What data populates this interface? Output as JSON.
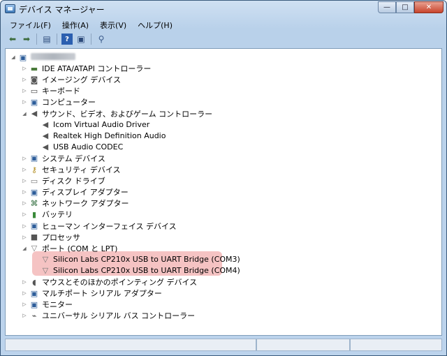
{
  "window": {
    "title": "デバイス マネージャー",
    "caption_buttons": {
      "minimize": "—",
      "maximize": "□",
      "close": "✕"
    }
  },
  "menu": [
    "ファイル(F)",
    "操作(A)",
    "表示(V)",
    "ヘルプ(H)"
  ],
  "toolbar": {
    "icons": [
      "back-icon",
      "forward-icon",
      "properties-icon",
      "help-icon",
      "view-icon",
      "scan-hardware-icon"
    ]
  },
  "tree": {
    "root_label": "",
    "categories": [
      {
        "label": "IDE ATA/ATAPI コントローラー",
        "icon": "ide-icon",
        "expanded": false
      },
      {
        "label": "イメージング デバイス",
        "icon": "camera-icon",
        "expanded": false
      },
      {
        "label": "キーボード",
        "icon": "keyboard-icon",
        "expanded": false
      },
      {
        "label": "コンピューター",
        "icon": "computer-icon",
        "expanded": false
      },
      {
        "label": "サウンド、ビデオ、およびゲーム コントローラー",
        "icon": "speaker-icon",
        "expanded": true,
        "children": [
          "Icom Virtual Audio Driver",
          "Realtek High Definition Audio",
          "USB Audio CODEC"
        ]
      },
      {
        "label": "システム デバイス",
        "icon": "system-icon",
        "expanded": false
      },
      {
        "label": "セキュリティ デバイス",
        "icon": "key-icon",
        "expanded": false
      },
      {
        "label": "ディスク ドライブ",
        "icon": "disk-icon",
        "expanded": false
      },
      {
        "label": "ディスプレイ アダプター",
        "icon": "display-icon",
        "expanded": false
      },
      {
        "label": "ネットワーク アダプター",
        "icon": "network-icon",
        "expanded": false
      },
      {
        "label": "バッテリ",
        "icon": "battery-icon",
        "expanded": false
      },
      {
        "label": "ヒューマン インターフェイス デバイス",
        "icon": "hid-icon",
        "expanded": false
      },
      {
        "label": "プロセッサ",
        "icon": "processor-icon",
        "expanded": false
      },
      {
        "label": "ポート (COM と LPT)",
        "icon": "port-icon",
        "expanded": true,
        "children": [
          "Silicon Labs CP210x USB to UART Bridge (COM3)",
          "Silicon Labs CP210x USB to UART Bridge (COM4)"
        ]
      },
      {
        "label": "マウスとそのほかのポインティング デバイス",
        "icon": "mouse-icon",
        "expanded": false
      },
      {
        "label": "マルチポート シリアル アダプター",
        "icon": "multiport-icon",
        "expanded": false
      },
      {
        "label": "モニター",
        "icon": "monitor-icon",
        "expanded": false
      },
      {
        "label": "ユニバーサル シリアル バス コントローラー",
        "icon": "usb-icon",
        "expanded": false
      }
    ]
  },
  "highlight_color": "#f3b8b8"
}
